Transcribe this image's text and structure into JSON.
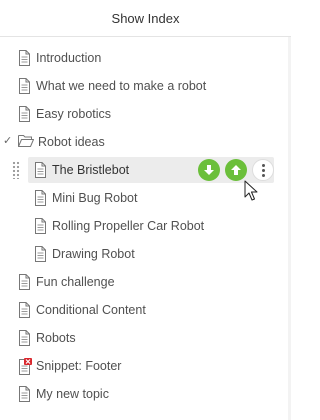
{
  "header": {
    "title": "Show Index"
  },
  "tree": {
    "items": [
      {
        "label": "Introduction",
        "icon": "page-icon"
      },
      {
        "label": "What we need to make a robot",
        "icon": "page-icon"
      },
      {
        "label": "Easy robotics",
        "icon": "page-icon"
      },
      {
        "label": "Robot ideas",
        "icon": "folder-open-icon",
        "expanded": true
      },
      {
        "label": "The Bristlebot",
        "icon": "page-icon",
        "selected": true
      },
      {
        "label": "Mini Bug Robot",
        "icon": "page-icon"
      },
      {
        "label": "Rolling Propeller Car Robot",
        "icon": "page-icon"
      },
      {
        "label": "Drawing Robot",
        "icon": "page-icon"
      },
      {
        "label": "Fun challenge",
        "icon": "page-icon"
      },
      {
        "label": "Conditional Content",
        "icon": "page-icon"
      },
      {
        "label": "Robots",
        "icon": "page-icon"
      },
      {
        "label": "Snippet: Footer",
        "icon": "snippet-icon"
      },
      {
        "label": "My new topic",
        "icon": "page-icon"
      }
    ]
  },
  "colors": {
    "accent_green": "#6bbf3a",
    "selection_bg": "#ececec",
    "snippet_red": "#d9262c"
  }
}
